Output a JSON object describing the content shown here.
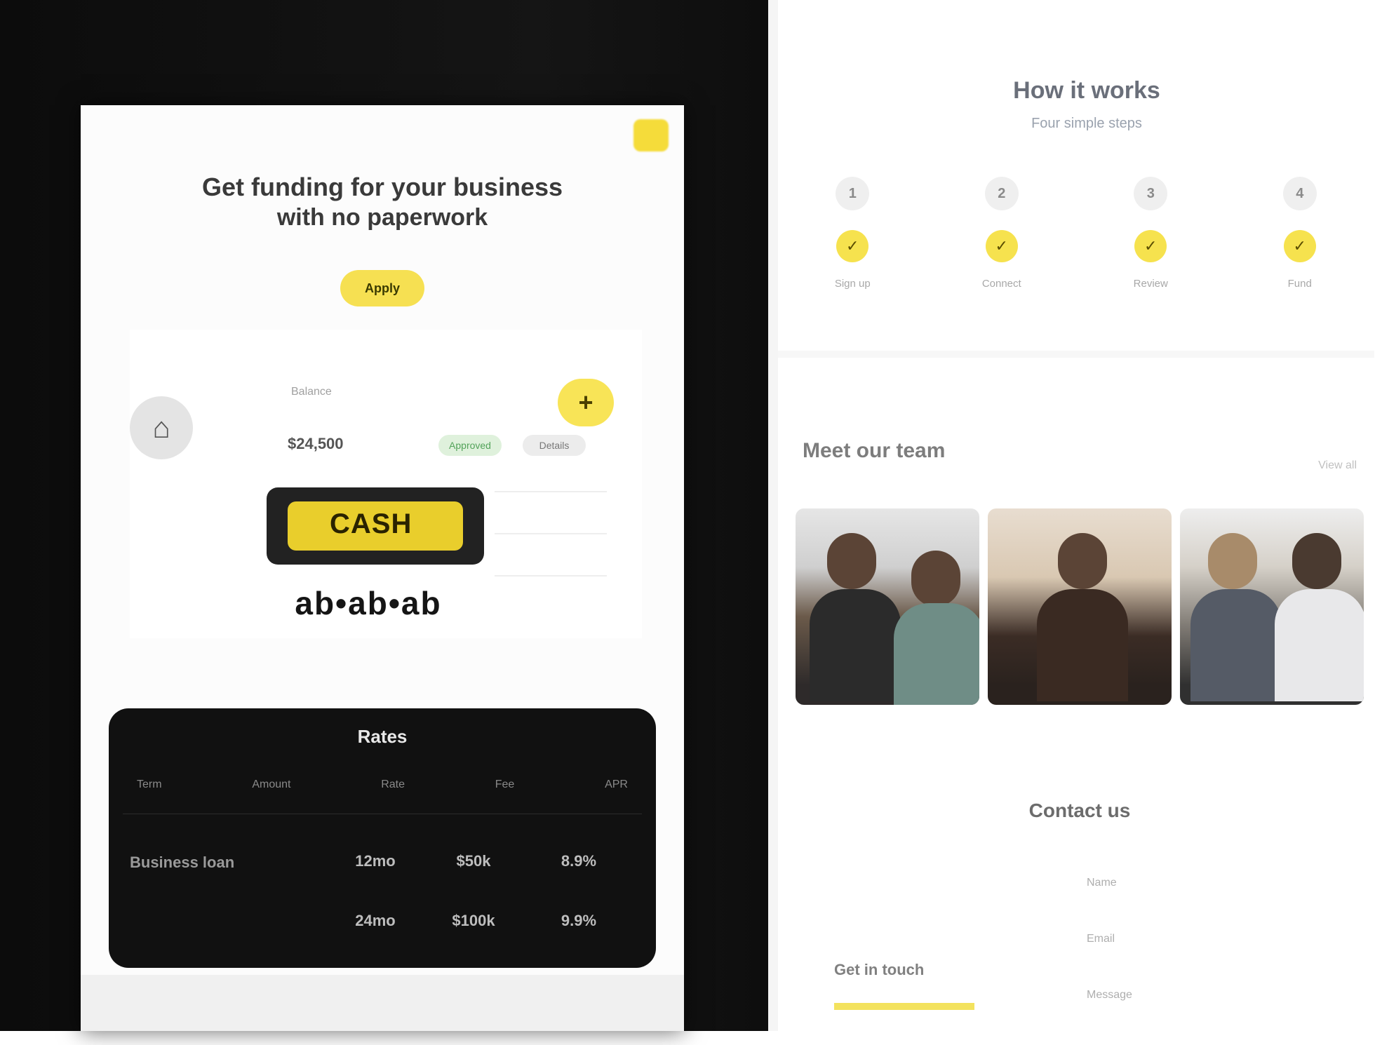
{
  "left_mockup": {
    "hero": {
      "heading_line1": "Get funding for your business",
      "heading_line2": "with no paperwork",
      "cta_label": "Apply"
    },
    "card": {
      "top_label": "Balance",
      "amount": "$24,500",
      "chip_green": "Approved",
      "chip_gray": "Details",
      "plus_label": "+",
      "badge_text": "CASH",
      "wordmark": "ab•ab•ab"
    },
    "panel": {
      "title": "Rates",
      "tabs": [
        "Term",
        "Amount",
        "Rate",
        "Fee",
        "APR"
      ],
      "row_label": "Business loan",
      "cells": [
        "12mo",
        "$50k",
        "8.9%",
        "24mo",
        "$100k",
        "9.9%"
      ]
    }
  },
  "right_page": {
    "title": "How it works",
    "subtitle": "Four simple steps",
    "steps": [
      {
        "num": "1",
        "icon": "check-icon",
        "label": "Sign up"
      },
      {
        "num": "2",
        "icon": "check-icon",
        "label": "Connect"
      },
      {
        "num": "3",
        "icon": "check-icon",
        "label": "Review"
      },
      {
        "num": "4",
        "icon": "check-icon",
        "label": "Fund"
      }
    ],
    "team": {
      "heading": "Meet our team",
      "link": "View all"
    },
    "contact": {
      "heading": "Contact us",
      "left_label": "Get in touch",
      "fields": [
        "Name",
        "Email",
        "Message"
      ]
    },
    "colors": {
      "accent": "#f5dc3a",
      "dark": "#111111"
    }
  }
}
